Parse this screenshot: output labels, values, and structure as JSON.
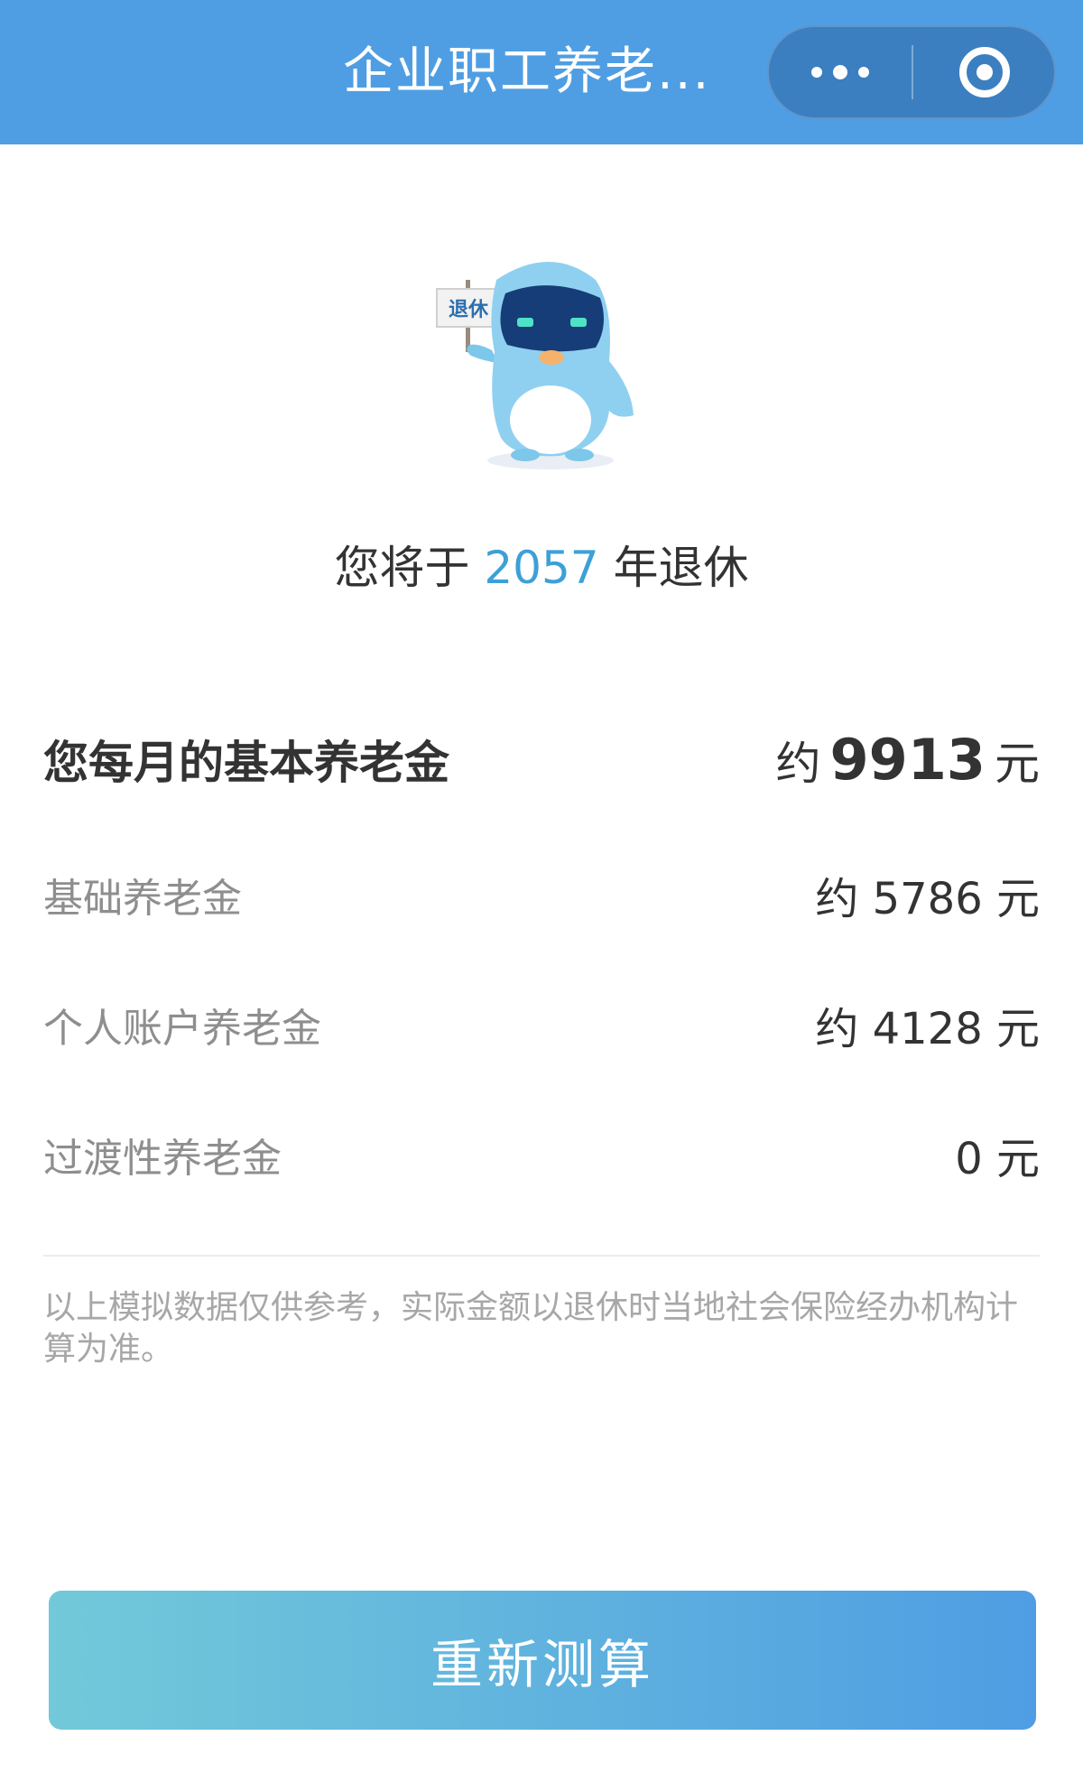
{
  "header": {
    "title": "企业职工养老...",
    "accent_color": "#4f9ee3",
    "more_icon": "more-dots-icon",
    "close_icon": "target-circle-icon"
  },
  "mascot": {
    "sign_text": "退休"
  },
  "retire": {
    "prefix": "您将于",
    "year": "2057",
    "suffix": "年退休"
  },
  "summary": {
    "label": "您每月的基本养老金",
    "prefix": "约",
    "amount": "9913",
    "unit": "元"
  },
  "items": [
    {
      "label": "基础养老金",
      "value": "约 5786 元"
    },
    {
      "label": "个人账户养老金",
      "value": "约 4128 元"
    },
    {
      "label": "过渡性养老金",
      "value": "0 元"
    }
  ],
  "note": "以上模拟数据仅供参考，实际金额以退休时当地社会保险经办机构计算为准。",
  "recalc_button": "重新测算"
}
